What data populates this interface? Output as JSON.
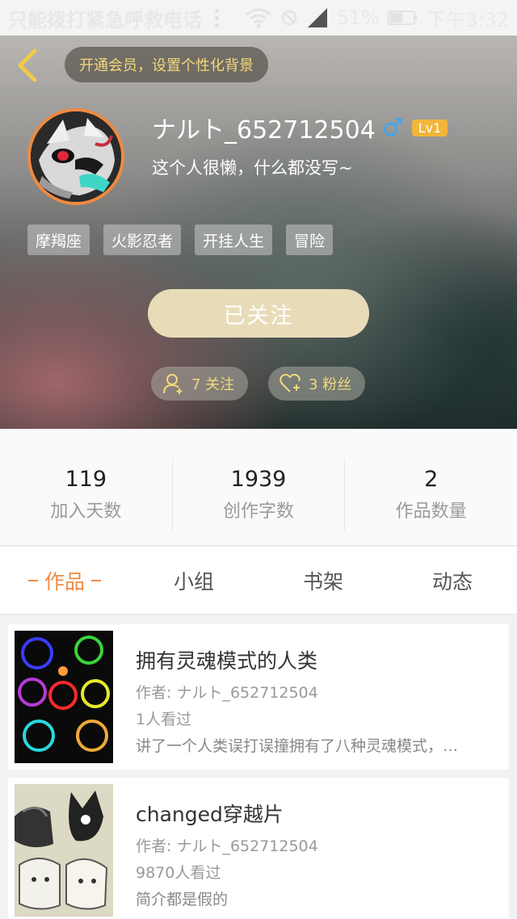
{
  "status_bar": {
    "carrier": "只能拨打紧急呼救电话",
    "battery": "51%",
    "time": "下午3:32"
  },
  "header": {
    "back_icon": "chevron-left-icon",
    "vip_text": "开通会员，设置个性化背景",
    "username": "ナルト_652712504",
    "gender_icon": "♂",
    "level": "Lv1",
    "bio": "这个人很懒，什么都没写~",
    "tags": [
      "摩羯座",
      "火影忍者",
      "开挂人生",
      "冒险"
    ],
    "follow_button": "已关注",
    "following_label": "7 关注",
    "fans_label": "3 粉丝"
  },
  "stats": [
    {
      "value": "119",
      "label": "加入天数"
    },
    {
      "value": "1939",
      "label": "创作字数"
    },
    {
      "value": "2",
      "label": "作品数量"
    }
  ],
  "tabs": [
    {
      "label": "作品",
      "active": true
    },
    {
      "label": "小组",
      "active": false
    },
    {
      "label": "书架",
      "active": false
    },
    {
      "label": "动态",
      "active": false
    }
  ],
  "works": [
    {
      "title": "拥有灵魂模式的人类",
      "author": "作者: ナルト_652712504",
      "views": "1人看过",
      "desc": "讲了一个人类误打误撞拥有了八种灵魂模式，…"
    },
    {
      "title": "changed穿越片",
      "author": "作者: ナルト_652712504",
      "views": "9870人看过",
      "desc": "简介都是假的"
    }
  ],
  "colors": {
    "accent": "#ef8a42",
    "gold": "#f3d97a",
    "follow_btn": "#e8dcb8",
    "male": "#3ea7f0"
  }
}
